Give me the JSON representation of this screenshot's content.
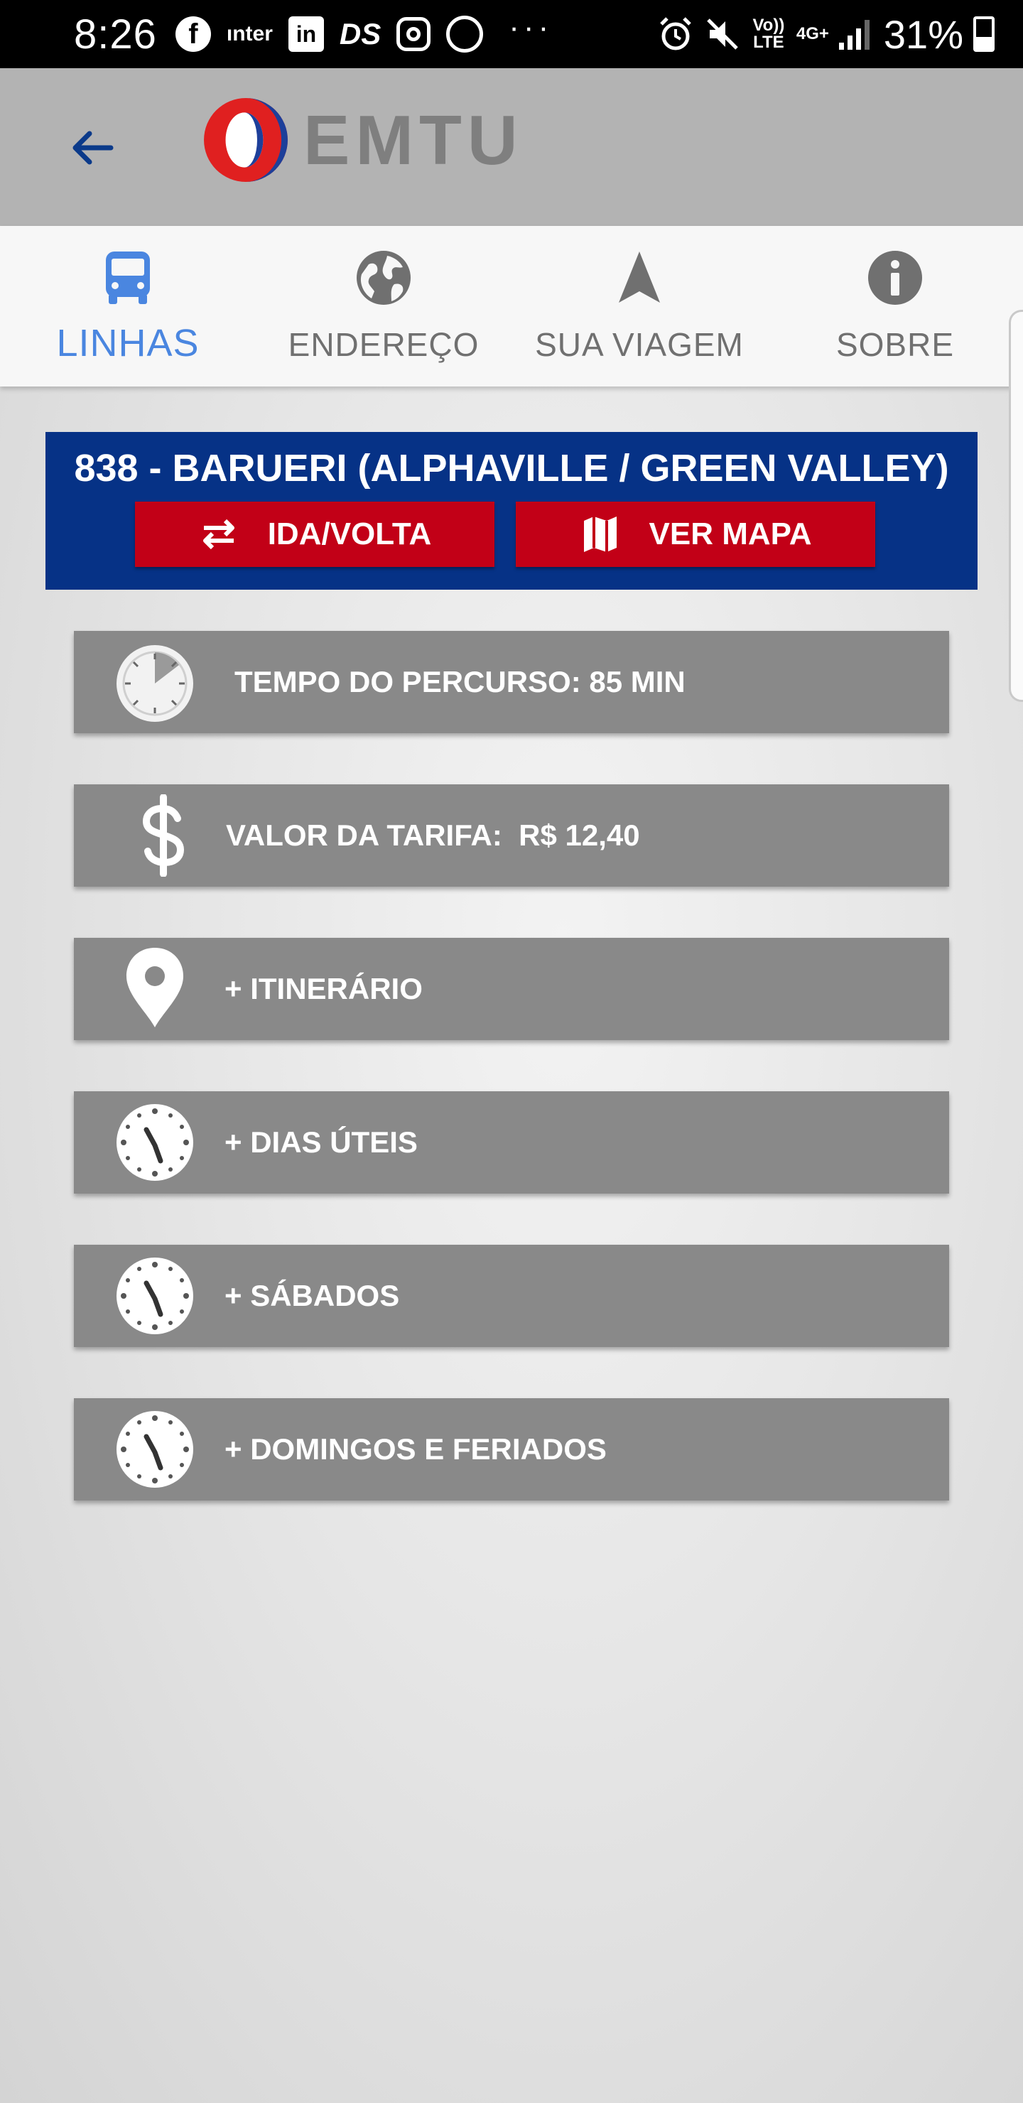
{
  "status_bar": {
    "time": "8:26",
    "app_icons": [
      "facebook-icon",
      "inter-icon",
      "linkedin-icon",
      "ds-icon",
      "instagram-icon",
      "whatsapp-icon"
    ],
    "inter_label": "ınter",
    "linkedin_label": "in",
    "ds_label": "DS",
    "more": "···",
    "volte_label": "Vo)) LTE",
    "network_label": "4G+",
    "battery": "31%"
  },
  "header": {
    "logo_text": "EMTU"
  },
  "tabs": [
    {
      "label": "LINHAS",
      "icon": "bus-icon",
      "active": true
    },
    {
      "label": "ENDEREÇO",
      "icon": "globe-icon",
      "active": false
    },
    {
      "label": "SUA VIAGEM",
      "icon": "navigation-arrow-icon",
      "active": false
    },
    {
      "label": "SOBRE",
      "icon": "info-icon",
      "active": false
    }
  ],
  "route": {
    "title": "838 -  BARUERI (ALPHAVILLE / GREEN VALLEY)",
    "ida_volta_label": "IDA/VOLTA",
    "ver_mapa_label": "VER MAPA"
  },
  "info_rows": [
    {
      "label": "TEMPO DO PERCURSO: 85 MIN",
      "icon": "stopwatch-icon"
    },
    {
      "label": "VALOR DA TARIFA:  R$ 12,40",
      "icon": "dollar-icon"
    },
    {
      "label": "+ ITINERÁRIO",
      "icon": "map-pin-icon"
    },
    {
      "label": "+ DIAS ÚTEIS",
      "icon": "clock-icon"
    },
    {
      "label": "+ SÁBADOS",
      "icon": "clock-icon"
    },
    {
      "label": "+ DOMINGOS E FERIADOS",
      "icon": "clock-icon"
    }
  ],
  "colors": {
    "header_bg": "#b3b3b3",
    "tab_active": "#4a86e0",
    "route_bg": "#063286",
    "button_red": "#c20017",
    "row_bg": "#898989"
  }
}
